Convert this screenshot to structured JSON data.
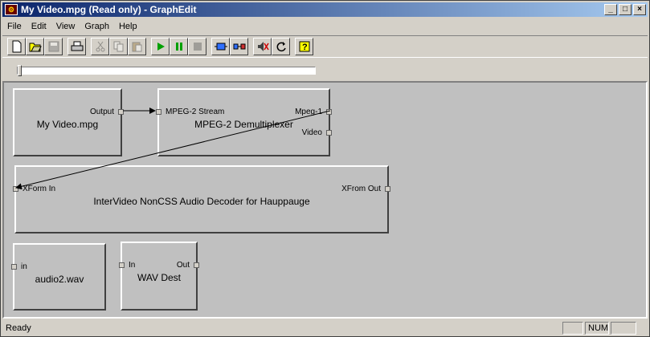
{
  "window": {
    "title": "My Video.mpg (Read only) - GraphEdit",
    "app_icon": "graphedit-icon"
  },
  "menu": [
    "File",
    "Edit",
    "View",
    "Graph",
    "Help"
  ],
  "toolbar": {
    "buttons": [
      "new-icon",
      "open-icon",
      "save-icon",
      "print-icon",
      "cut-icon",
      "copy-icon",
      "paste-icon",
      "play-icon",
      "pause-icon",
      "stop-icon",
      "insert-filter-icon",
      "connect-icon",
      "mute-icon",
      "refresh-icon",
      "help-icon"
    ]
  },
  "seekbar": {
    "position": 0
  },
  "filters": {
    "source": {
      "name": "My Video.mpg",
      "pins_out": [
        "Output"
      ]
    },
    "demux": {
      "name": "MPEG-2 Demultiplexer",
      "pins_in": [
        "MPEG-2 Stream"
      ],
      "pins_out": [
        "Mpeg-1",
        "Video"
      ]
    },
    "decoder": {
      "name": "InterVideo NonCSS Audio Decoder for Hauppauge",
      "pins_in": [
        "XForm In"
      ],
      "pins_out": [
        "XFrom Out"
      ]
    },
    "wav": {
      "name": "audio2.wav",
      "pins_in": [
        "in"
      ]
    },
    "wavdest": {
      "name": "WAV Dest",
      "pins_in": [
        "In"
      ],
      "pins_out": [
        "Out"
      ]
    }
  },
  "status": {
    "text": "Ready",
    "panes": [
      "",
      "NUM",
      ""
    ]
  }
}
